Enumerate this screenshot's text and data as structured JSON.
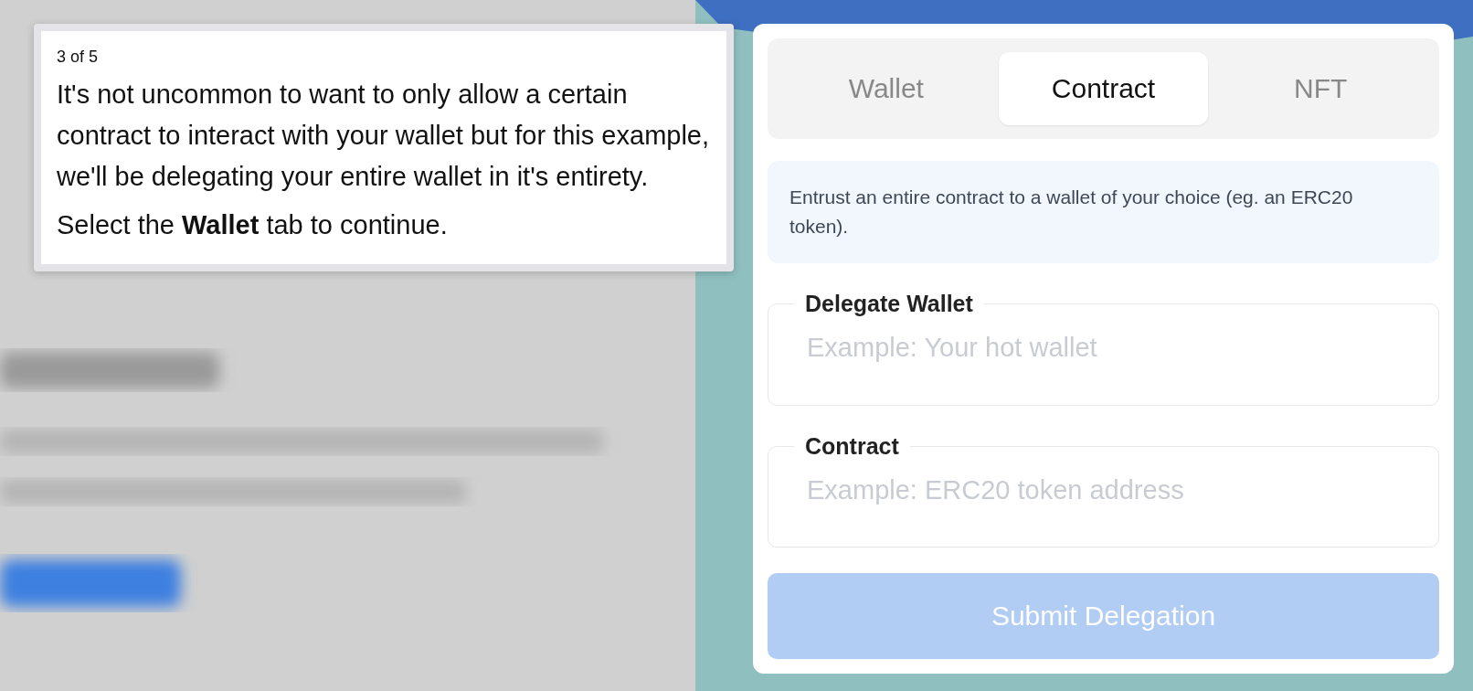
{
  "tour": {
    "step": "3 of 5",
    "paragraphs": [
      "It's not uncommon to want to only allow a certain contract to interact with your wallet but for this example, we'll be delegating your entire wallet in it's entirety.",
      "Select the **Wallet** tab to continue."
    ]
  },
  "tabs": [
    {
      "label": "Wallet",
      "selected": false
    },
    {
      "label": "Contract",
      "selected": true
    },
    {
      "label": "NFT",
      "selected": false
    }
  ],
  "info": "Entrust an entire contract to a wallet of your choice (eg. an ERC20 token).",
  "fields": [
    {
      "label": "Delegate Wallet",
      "placeholder": "Example: Your hot wallet"
    },
    {
      "label": "Contract",
      "placeholder": "Example: ERC20 token address"
    }
  ],
  "submit": {
    "label": "Submit Delegation",
    "disabled": true
  }
}
